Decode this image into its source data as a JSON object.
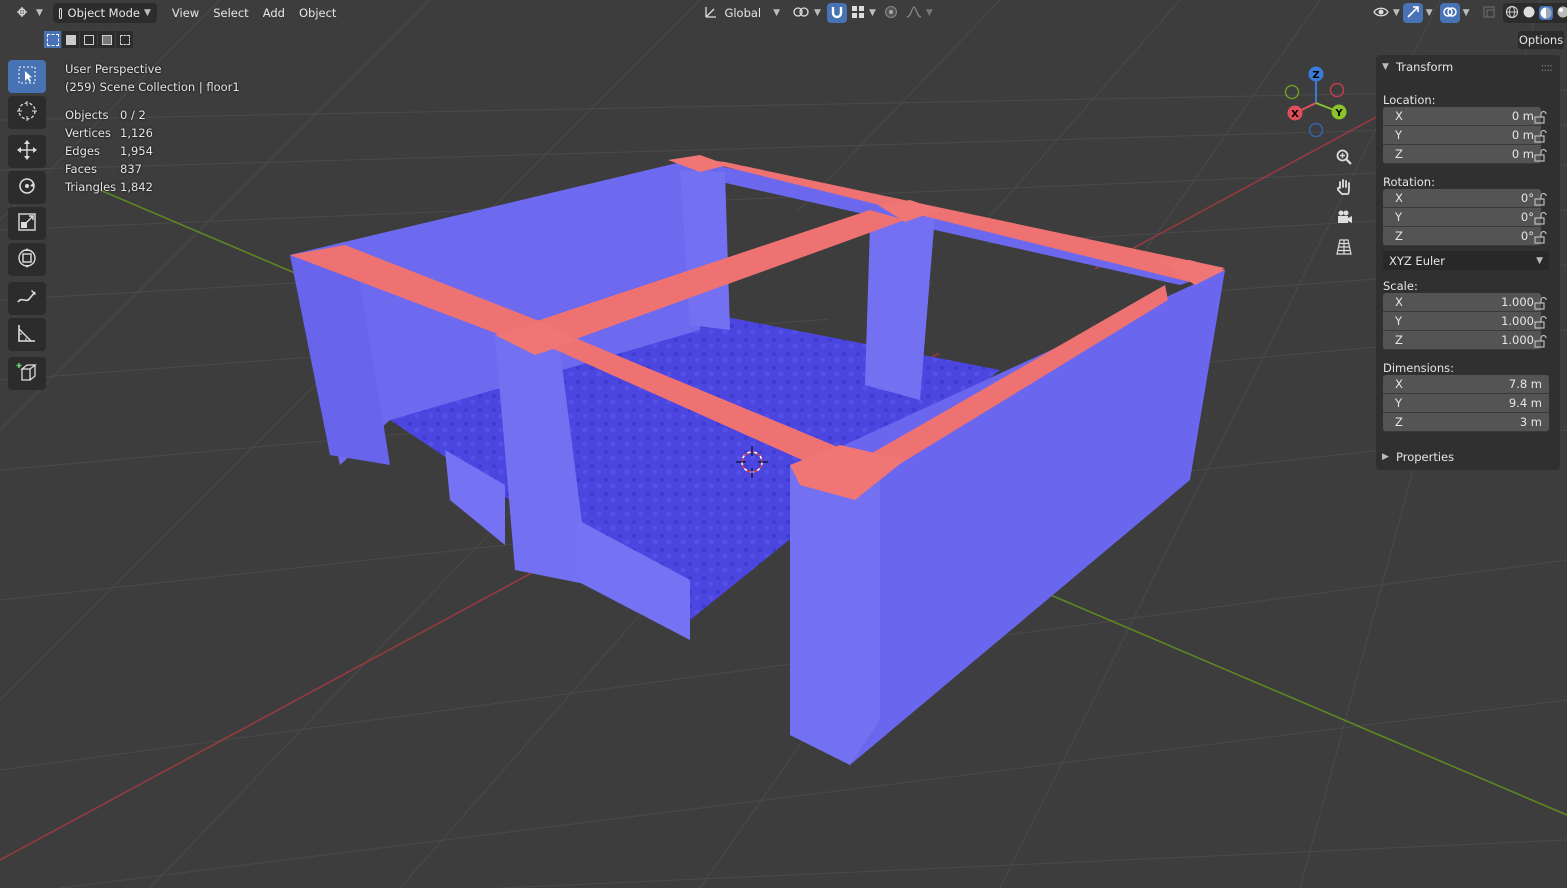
{
  "header": {
    "mode_label": "Object Mode",
    "menus": [
      "View",
      "Select",
      "Add",
      "Object"
    ],
    "orientation_label": "Global"
  },
  "overlay": {
    "perspective": "User Perspective",
    "collection": "(259) Scene Collection | floor1"
  },
  "stats": [
    {
      "label": "Objects",
      "value": "0 / 2"
    },
    {
      "label": "Vertices",
      "value": "1,126"
    },
    {
      "label": "Edges",
      "value": "1,954"
    },
    {
      "label": "Faces",
      "value": "837"
    },
    {
      "label": "Triangles",
      "value": "1,842"
    }
  ],
  "gizmo": {
    "x": "X",
    "y": "Y",
    "z": "Z"
  },
  "options_label": "Options",
  "panel": {
    "transform_title": "Transform",
    "location_label": "Location:",
    "location": {
      "x": "0 m",
      "y": "0 m",
      "z": "0 m"
    },
    "rotation_label": "Rotation:",
    "rotation": {
      "x": "0°",
      "y": "0°",
      "z": "0°"
    },
    "rotation_mode": "XYZ Euler",
    "scale_label": "Scale:",
    "scale": {
      "x": "1.000",
      "y": "1.000",
      "z": "1.000"
    },
    "dimensions_label": "Dimensions:",
    "dimensions": {
      "x": "7.8 m",
      "y": "9.4 m",
      "z": "3 m"
    },
    "properties_title": "Properties",
    "axis_x": "X",
    "axis_y": "Y",
    "axis_z": "Z"
  },
  "colors": {
    "wall": "#6b66ee",
    "top": "#ef7272",
    "floor": "#4a45dd",
    "active": "#4772b3",
    "axis_red": "#b8333f",
    "axis_green": "#6a9a1c"
  }
}
